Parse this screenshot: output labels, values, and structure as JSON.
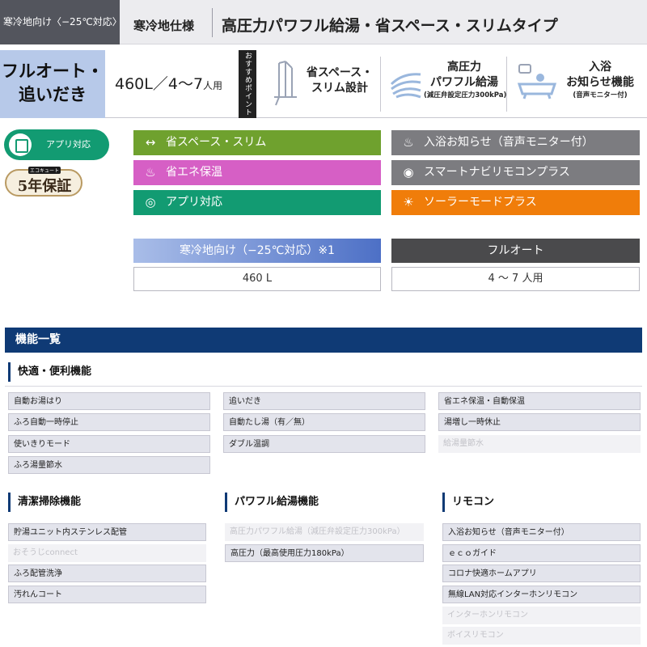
{
  "header": {
    "cold_region": "寒冷地向け〈−25℃対応〉",
    "spec": "寒冷地仕様",
    "type": "高圧力パワフル給湯・省スペース・スリムタイプ"
  },
  "product": {
    "full_auto_line1": "フルオート・",
    "full_auto_line2": "追いだき",
    "capacity_main": "460L／4〜7",
    "capacity_unit": "人用",
    "point_label": "おすすめポイント",
    "features": [
      {
        "line1": "省スペース・",
        "line2": "スリム設計",
        "sub": ""
      },
      {
        "line1": "高圧力",
        "line2": "パワフル給湯",
        "sub": "(減圧弁設定圧力300kPa)"
      },
      {
        "line1": "入浴",
        "line2": "お知らせ機能",
        "sub": "(音声モニター付)"
      }
    ]
  },
  "badges": {
    "app": "アプリ対応",
    "warranty_top": "エコキュート",
    "warranty_main": "5年保証"
  },
  "feature_buttons": [
    {
      "label": "省スペース・スリム",
      "icon": "arrows-horizontal-icon",
      "color": "#6fa12e"
    },
    {
      "label": "省エネ保温",
      "icon": "bathtub-heat-icon",
      "color": "#d65fc5"
    },
    {
      "label": "アプリ対応",
      "icon": "app-icon",
      "color": "#129b72"
    },
    {
      "label": "入浴お知らせ（音声モニター付）",
      "icon": "bath-notice-icon",
      "color": "#7c7c80"
    },
    {
      "label": "スマートナビリモコンプラス",
      "icon": "navi-icon",
      "color": "#7c7c80"
    },
    {
      "label": "ソーラーモードプラス",
      "icon": "sun-icon",
      "color": "#f07d0a"
    }
  ],
  "specs": [
    {
      "header": "寒冷地向け（−25℃対応）※1",
      "value": "460 L"
    },
    {
      "header": "フルオート",
      "value": "4 〜 7 人用"
    }
  ],
  "features_title": "機能一覧",
  "sections": {
    "comfort": {
      "title": "快適・便利機能",
      "col1": [
        {
          "label": "自動お湯はり",
          "on": true
        },
        {
          "label": "ふろ自動一時停止",
          "on": true
        },
        {
          "label": "使いきりモード",
          "on": true
        },
        {
          "label": "ふろ湯量節水",
          "on": true
        }
      ],
      "col2": [
        {
          "label": "追いだき",
          "on": true
        },
        {
          "label": "自動たし湯（有／無）",
          "on": true
        },
        {
          "label": "ダブル温調",
          "on": true
        }
      ],
      "col3": [
        {
          "label": "省エネ保温・自動保温",
          "on": true
        },
        {
          "label": "湯増し一時休止",
          "on": true
        },
        {
          "label": "給湯量節水",
          "on": false
        }
      ]
    },
    "clean": {
      "title": "清潔掃除機能",
      "items": [
        {
          "label": "貯湯ユニット内ステンレス配管",
          "on": true
        },
        {
          "label": "おそうじconnect",
          "on": false
        },
        {
          "label": "ふろ配管洗浄",
          "on": true
        },
        {
          "label": "汚れんコート",
          "on": true
        }
      ]
    },
    "power": {
      "title": "パワフル給湯機能",
      "items": [
        {
          "label": "高圧力パワフル給湯（減圧弁設定圧力300kPa）",
          "on": false
        },
        {
          "label": "高圧力（最高使用圧力180kPa）",
          "on": true
        }
      ]
    },
    "remote": {
      "title": "リモコン",
      "items": [
        {
          "label": "入浴お知らせ（音声モニター付）",
          "on": true
        },
        {
          "label": "ｅｃｏガイド",
          "on": true
        },
        {
          "label": "コロナ快適ホームアプリ",
          "on": true
        },
        {
          "label": "無線LAN対応インターホンリモコン",
          "on": true
        },
        {
          "label": "インターホンリモコン",
          "on": false
        },
        {
          "label": "ボイスリモコン",
          "on": false
        }
      ]
    }
  },
  "colors": {
    "navy": "#0f3a75",
    "spec_header_gradient_from": "#a9bde8",
    "spec_header_gradient_to": "#4d70c6",
    "spec_header_dark": "#4a4a4c"
  }
}
